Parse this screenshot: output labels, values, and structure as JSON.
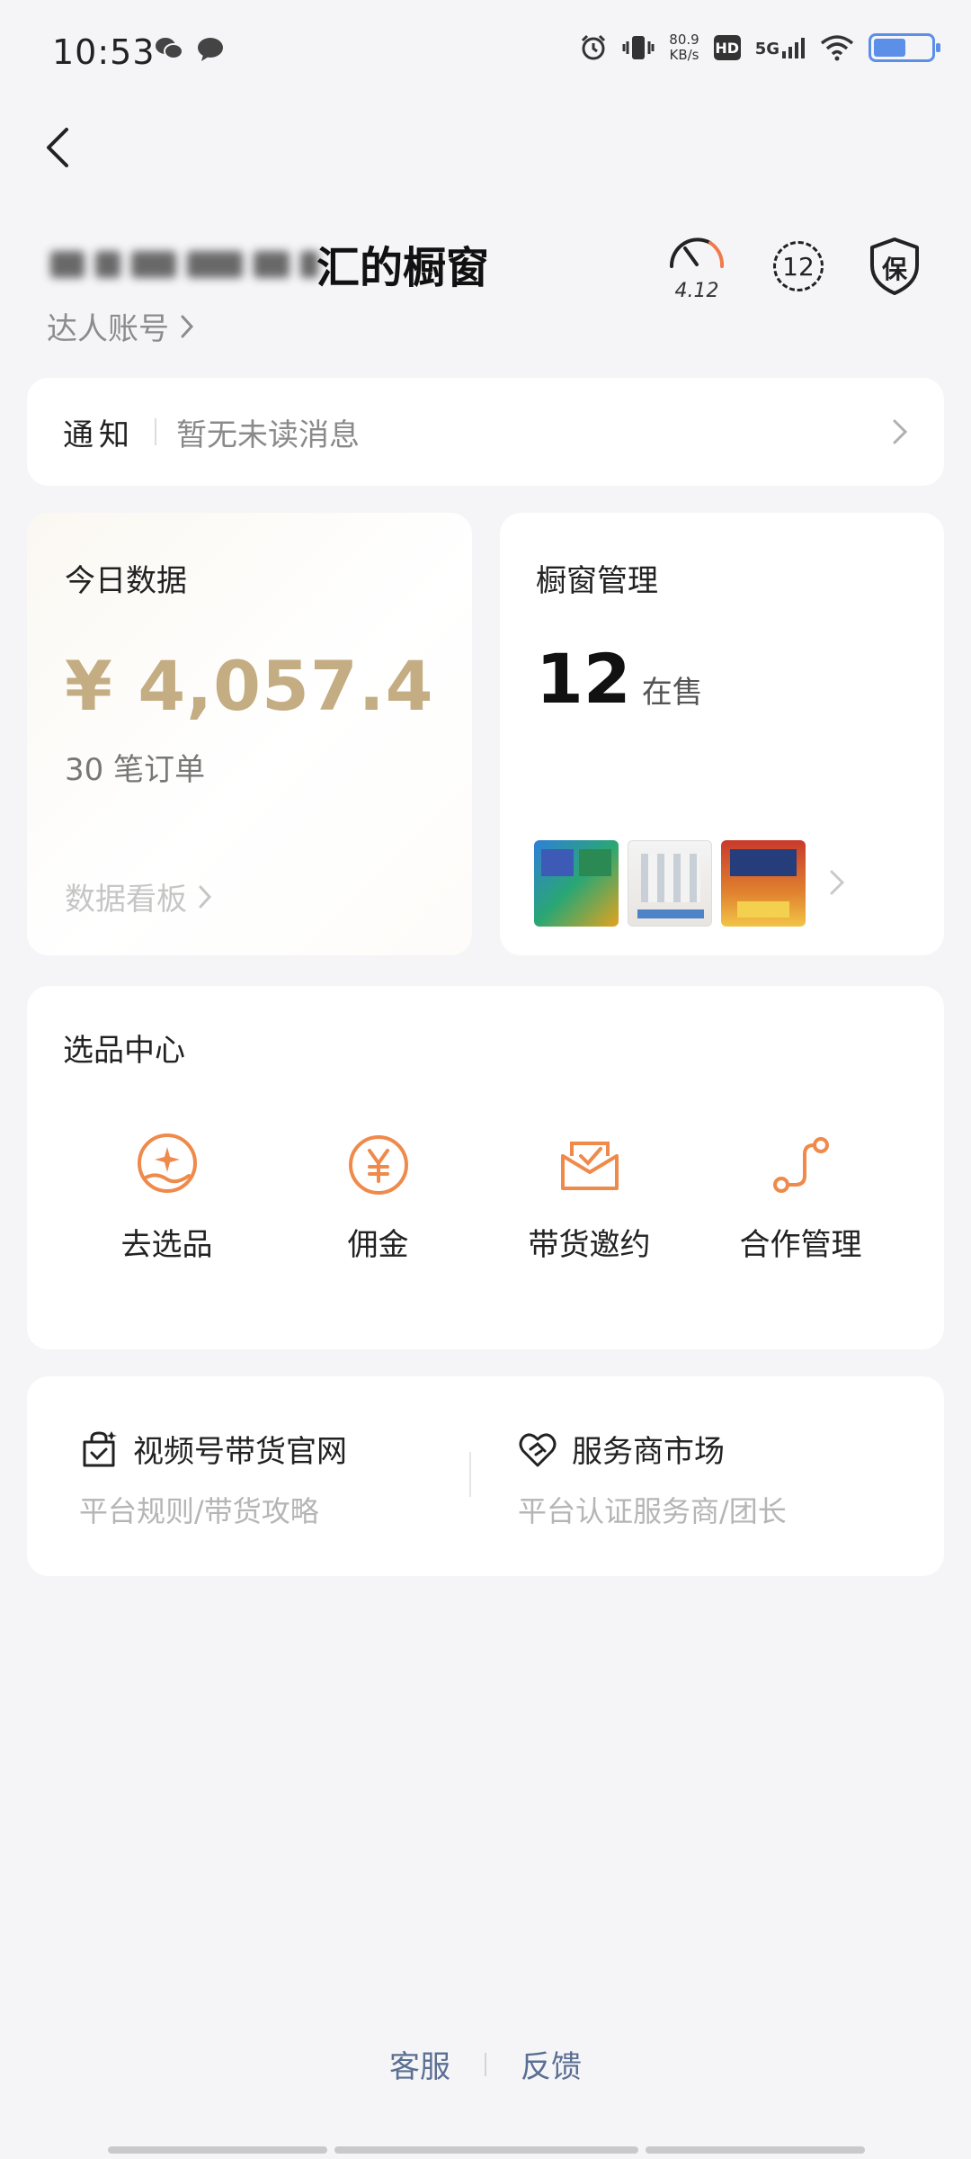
{
  "status_bar": {
    "time": "10:53",
    "net_speed_value": "80.9",
    "net_speed_unit": "KB/s",
    "hd_label": "HD",
    "network_label": "5G",
    "battery_level": 0.6
  },
  "header": {
    "title": "汇的橱窗",
    "account_link": "达人账号",
    "score": "4.12",
    "badge_count": "12",
    "protect_label": "保"
  },
  "notice": {
    "label": "通知",
    "text": "暂无未读消息"
  },
  "today": {
    "title": "今日数据",
    "amount": "¥ 4,057.4",
    "orders": "30 笔订单",
    "link": "数据看板"
  },
  "showcase": {
    "title": "橱窗管理",
    "count": "12",
    "unit": "在售"
  },
  "picks": {
    "title": "选品中心",
    "items": [
      {
        "label": "去选品",
        "icon": "select-product-icon"
      },
      {
        "label": "佣金",
        "icon": "yen-commission-icon"
      },
      {
        "label": "带货邀约",
        "icon": "invitation-envelope-icon"
      },
      {
        "label": "合作管理",
        "icon": "cooperation-path-icon"
      }
    ]
  },
  "links": {
    "left": {
      "title": "视频号带货官网",
      "sub": "平台规则/带货攻略"
    },
    "right": {
      "title": "服务商市场",
      "sub": "平台认证服务商/团长"
    }
  },
  "footer": {
    "service": "客服",
    "feedback": "反馈"
  },
  "colors": {
    "accent_gold": "#c4ac83",
    "accent_orange": "#ef8a4b",
    "footer_link": "#5b6f93"
  }
}
